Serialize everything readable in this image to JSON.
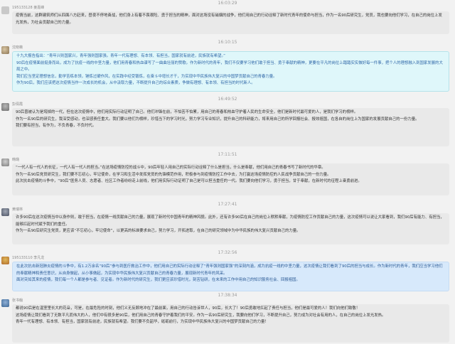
{
  "timestamps": [
    "16:03:29",
    "16:10:15",
    "16:49:52",
    "17:11:51",
    "17:27:41",
    "17:32:56",
    "17:38:34"
  ],
  "messages": [
    {
      "nick": "195133128 姜嘉峰",
      "style": "gray",
      "paragraphs": [
        "疫情当前，这群建筑师们从四面八方赶来，昼夜不停地奋战，他们身上有着不畏艰险、勇于担当的精神，面对这场没有硝烟的战争，他们用自己的行动诠释了新时代青年的使命与担当，作为一名90后研究生，党员，我也要向他们学习，在自己的岗位上发光发热，为社会贡献自己的力量。"
      ]
    },
    {
      "nick": "沈晓薇",
      "style": "cyan",
      "paragraphs": [
        "十九大报告指出：“青年兴则国家兴，青年强则国家强。青年一代有理想、有本领、有担当，国家就有前途，民族就有希望。”",
        "90后在疫情面前挺身而出，成为了抗疫一线的中坚力量，他们用青春和热血谱写了一曲曲壮丽的赞歌。作为新时代的青年，我们不仅要学习他们敢于担当、勇于奉献的精神，更要在平凡的岗位上踏踏实实做好每一件事，把个人的理想融入到国家发展的大局之中。",
        "我们应当坚定理想信念，勤学苦练本领，锤炼过硬作风，在实践中经受锻炼，在奋斗中增长才干，为实现中华民族伟大复兴的中国梦贡献自己的青春力量。",
        "作为90后，我们应该把这次疫情当作一次成长的机会，从中汲取力量，不断提升自己的综合素质，争做有理想、有本领、有担当的时代新人。"
      ]
    },
    {
      "nick": "彭倩霞",
      "style": "gray",
      "paragraphs": [
        "90后曾被认为是垮掉的一代，但在这次疫情中，他们用实际行动证明了自己。他们冲锋在前，不怕苦不怕累，用自己的青春和热血守护着人民的生命安全，他们是新时代最可爱的人，是我们学习的榜样。",
        "作为一名90后的研究生，我深受感动，也深感责任重大。我们要以他们为榜样，珍惜当下的学习时光，努力学习专业知识，提升自己的科研能力，将来用自己的所学回报社会、报效祖国，在各自的岗位上为国家的发展贡献自己的一份力量。",
        "我们要有担当，有作为，不负青春，不负时代。"
      ]
    },
    {
      "nick": "韩璐",
      "style": "gray",
      "paragraphs": [
        "“一代人有一代人的长征，一代人有一代人的担当。”在这场疫情防控的战斗中，90后年轻人用自己的实际行动诠释了什么是担当，什么是奉献，他们用自己的青春书写了新时代的华章。",
        "作为一名90后党员研究生，我们要不忘初心，牢记使命，在学习和生活中发挥党员的先锋模范作用，积极参与到疫情防控工作中去，为打赢这场疫情防控的人民战争贡献自己的一份力量。",
        "此次抗击疫情的斗争中，“90后”医务人员、志愿者、社区工作者纷纷走上前线，他们用实际行动证明了自己是可以担当重任的一代。我们要向他们学习，勇于担当，甘于奉献，在新时代的征程上奋勇前进。"
      ]
    },
    {
      "nick": "黄瑞林",
      "style": "gray",
      "paragraphs": [
        "许多90后在这次疫情当中以身作则，敢于担当，在疫情一线贡献自己的力量，展现了新时代中国青年的精神风貌。此外，还有许多90后在自己的岗位上默默奉献，为疫情防控工作贡献自己的力量，这次疫情可以说让大家看到，我们90后有能力、有担当，能够扛起时代赋予我们的重任。",
        "作为一名90后研究生党员，更应该“不忘初心，牢记使命”，以更高的标准要求自己，努力学习，开拓进取，在自己的研究领域中为中华民族的伟大复兴贡献自己的力量。"
      ]
    },
    {
      "nick": "195133110 李凡龙",
      "style": "blue",
      "paragraphs": [
        "在此次抗击新冠肺炎疫情的斗争中，有1.2万余名“90后”参与到医疗救治工作中，他们用自己的实际行动诠释了“青年强则国家强”的深刻内涵，成为抗疫一线的中坚力量，这次疫情让我们看到了90后的担当与成长。作为新时代的青年，我们应当学习他们的奉献精神和责任意识，从自身做起，从小事做起，为实现中华民族伟大复兴贡献自己的青春力量，展现新时代青年的风采。",
        "面对突如其来的疫情，我们每一个人都是参与者、见证者。作为新时代的研究生，我们更应该珍惜时光，刻苦钻研，在未来的工作中用自己的知识服务社会、回报祖国。"
      ]
    },
    {
      "nick": "张书翰",
      "style": "gray",
      "paragraphs": [
        "都说90后是在温室里长大的花朵，可是，在最危险的时刻，他们义无反顾地冲在了最前面，用自己的行动告诉世人，90后，长大了！90后勇敢地扛起了责任与担当，他们是最可爱的人！我们向他们致敬！",
        "这场疫情让我们看到了无数平凡而伟大的人，他们中有很多是90后，他们用自己的青春守护着我们的平安。作为一名90后研究生，我要向他们学习，不断提升自己，努力成为对社会有用的人，在自己的岗位上发光发热。",
        "青年一代有理想、有本领、有担当，国家就有前途，民族就有希望。我们要不负韶华，砥砺前行，为实现中华民族伟大复兴的中国梦贡献自己的力量！"
      ]
    }
  ]
}
